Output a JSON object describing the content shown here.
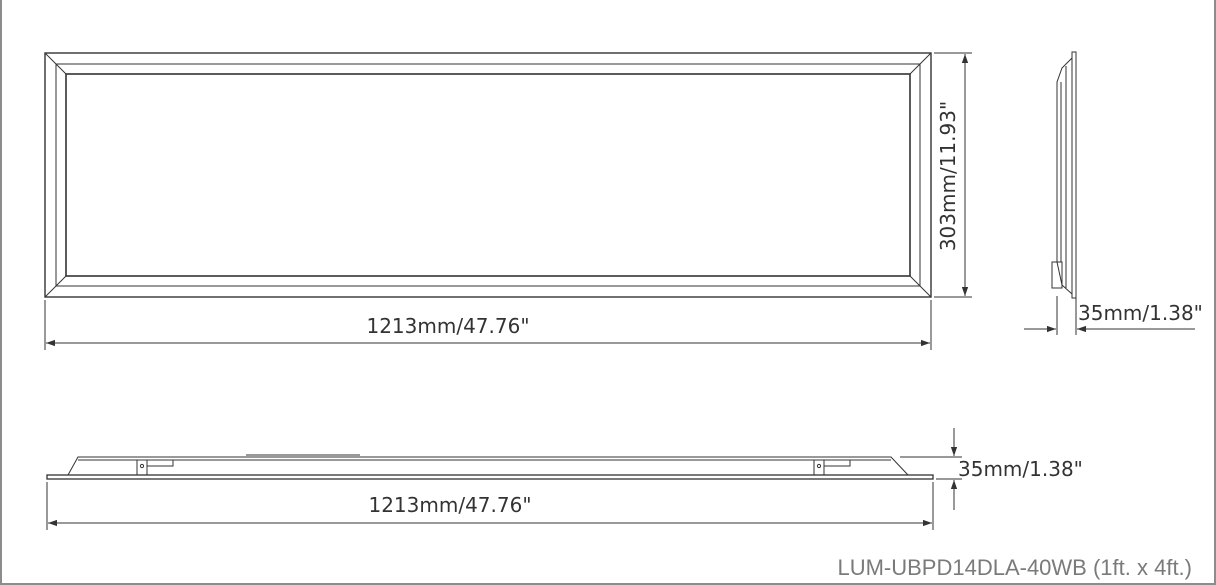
{
  "dimensions": {
    "front_width": "1213mm/47.76\"",
    "front_height": "303mm/11.93\"",
    "side_depth": "35mm/1.38\"",
    "bottom_depth": "35mm/1.38\"",
    "bottom_width": "1213mm/47.76\""
  },
  "model_label": "LUM-UBPD14DLA-40WB (1ft. x 4ft.)",
  "colors": {
    "line": "#333333",
    "frame_border": "#8c8c8c",
    "label": "#7a7a7a"
  }
}
